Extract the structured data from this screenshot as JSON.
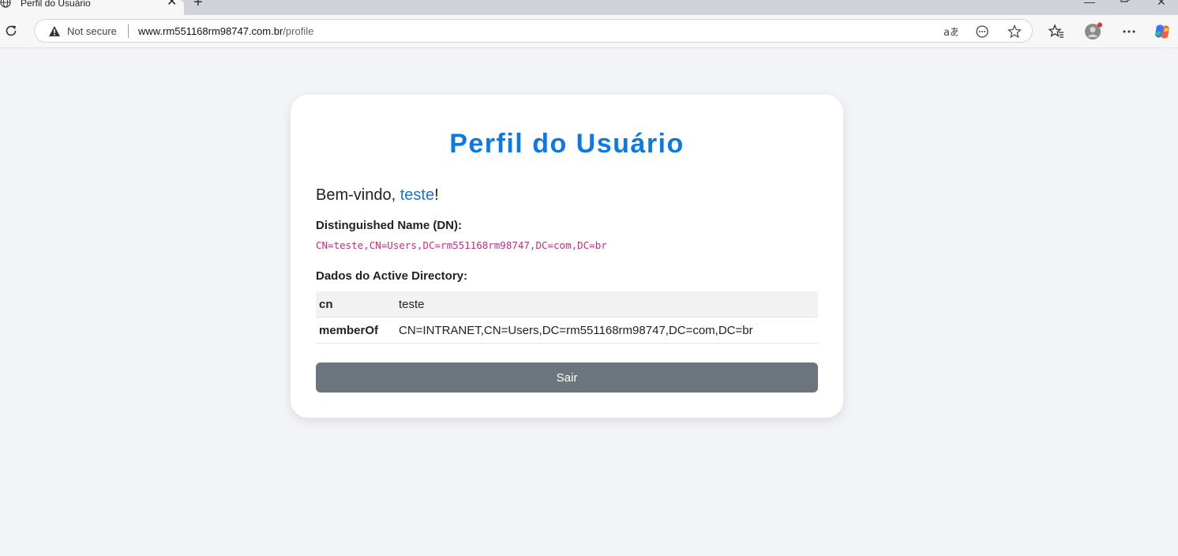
{
  "browser": {
    "tab_title": "Perfil do Usuário",
    "security_label": "Not secure",
    "url_host": "www.rm551168rm98747.com.br",
    "url_path": "/profile"
  },
  "page": {
    "title": "Perfil do Usuário",
    "welcome_prefix": "Bem-vindo, ",
    "username": "teste",
    "welcome_suffix": "!",
    "dn_label": "Distinguished Name (DN):",
    "dn_value": "CN=teste,CN=Users,DC=rm551168rm98747,DC=com,DC=br",
    "ad_label": "Dados do Active Directory:",
    "ad_rows": [
      {
        "key": "cn",
        "value": "teste"
      },
      {
        "key": "memberOf",
        "value": "CN=INTRANET,CN=Users,DC=rm551168rm98747,DC=com,DC=br"
      }
    ],
    "logout_label": "Sair"
  },
  "colors": {
    "title": "#0d79e6",
    "dn_text": "#c0307f",
    "button": "#6c757d",
    "background": "#f3f4f8"
  },
  "icons": [
    "globe-icon",
    "close-icon",
    "plus-icon",
    "minimize-icon",
    "restore-icon",
    "window-close-icon",
    "reload-icon",
    "warning-icon",
    "read-aloud-icon",
    "more-tools-icon",
    "star-icon",
    "favorites-icon",
    "profile-icon",
    "menu-dots-icon",
    "copilot-icon"
  ]
}
